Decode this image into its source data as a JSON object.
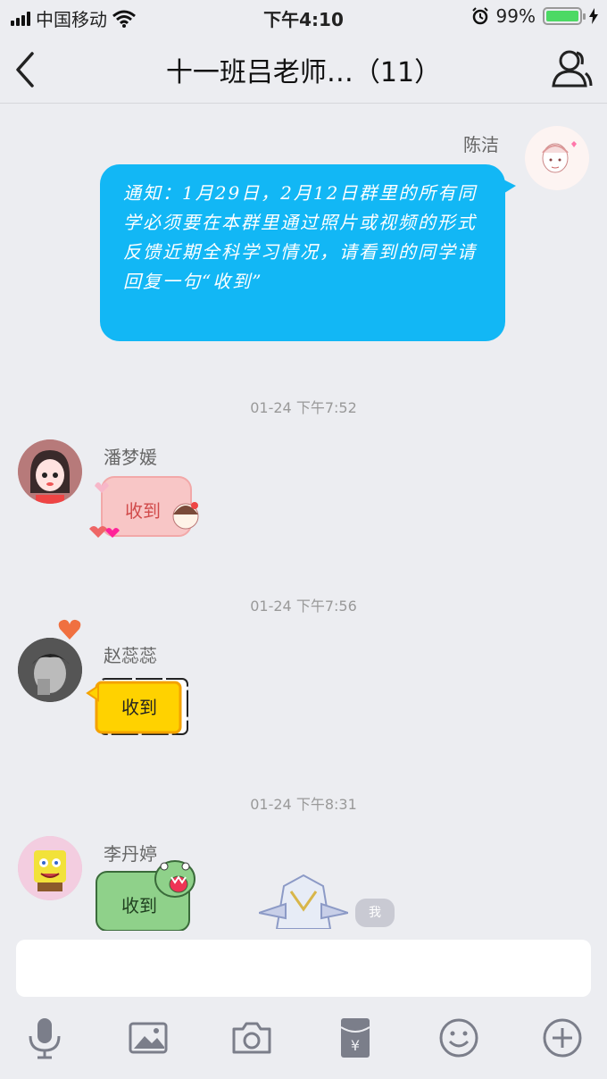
{
  "status_bar": {
    "carrier": "中国移动",
    "time": "下午4:10",
    "battery_percent": "99%",
    "battery_level": 0.99,
    "icons": [
      "signal-icon",
      "wifi-icon",
      "alarm-icon",
      "battery-icon",
      "charging-icon"
    ]
  },
  "nav": {
    "title": "十一班吕老师…（11）",
    "back_icon": "chevron-left-icon",
    "profile_icon": "group-profile-icon"
  },
  "messages": [
    {
      "sender": "陈洁",
      "text": "通知：1月29日，2月12日群里的所有同学必须要在本群里通过照片或视频的形式反馈近期全科学习情况，请看到的同学请回复一句“收到”"
    },
    {
      "time": "01-24 下午7:52",
      "sender": "潘梦媛",
      "sticker_text": "收到"
    },
    {
      "time": "01-24 下午7:56",
      "sender": "赵蕊蕊",
      "sticker_text": "收到"
    },
    {
      "time": "01-24 下午8:31",
      "sender": "李丹婷",
      "sticker_text": "收到",
      "me_tag": "我"
    }
  ],
  "input": {
    "placeholder": ""
  },
  "toolbar": {
    "icons": [
      "microphone-icon",
      "image-icon",
      "camera-icon",
      "red-packet-icon",
      "emoji-icon",
      "plus-icon"
    ]
  },
  "colors": {
    "background": "#ecedf1",
    "bubble_blue": "#12b7f5",
    "battery_green": "#4cd964"
  }
}
